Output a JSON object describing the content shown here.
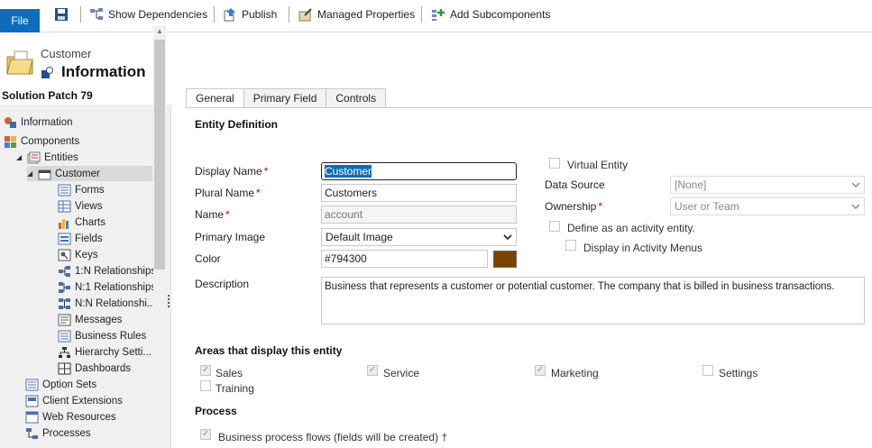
{
  "toolbar": {
    "file": "File",
    "show_dependencies": "Show Dependencies",
    "publish": "Publish",
    "managed_properties": "Managed Properties",
    "add_subcomponents": "Add Subcomponents"
  },
  "header": {
    "entity": "Customer",
    "title": "Information"
  },
  "sidebar": {
    "solution": "Solution Patch 79",
    "items": [
      {
        "label": "Information"
      },
      {
        "label": "Components"
      },
      {
        "label": "Entities"
      },
      {
        "label": "Customer"
      },
      {
        "label": "Forms"
      },
      {
        "label": "Views"
      },
      {
        "label": "Charts"
      },
      {
        "label": "Fields"
      },
      {
        "label": "Keys"
      },
      {
        "label": "1:N Relationships"
      },
      {
        "label": "N:1 Relationships"
      },
      {
        "label": "N:N Relationshi..."
      },
      {
        "label": "Messages"
      },
      {
        "label": "Business Rules"
      },
      {
        "label": "Hierarchy Setti..."
      },
      {
        "label": "Dashboards"
      },
      {
        "label": "Option Sets"
      },
      {
        "label": "Client Extensions"
      },
      {
        "label": "Web Resources"
      },
      {
        "label": "Processes"
      }
    ]
  },
  "tabs": [
    "General",
    "Primary Field",
    "Controls"
  ],
  "form": {
    "entity_definition": "Entity Definition",
    "display_name_label": "Display Name",
    "display_name_value": "Customer",
    "plural_name_label": "Plural Name",
    "plural_name_value": "Customers",
    "name_label": "Name",
    "name_value": "account",
    "primary_image_label": "Primary Image",
    "primary_image_value": "Default Image",
    "color_label": "Color",
    "color_value": "#794300",
    "description_label": "Description",
    "description_value": "Business that represents a customer or potential customer. The company that is billed in business transactions.",
    "virtual_entity": "Virtual Entity",
    "data_source_label": "Data Source",
    "data_source_value": "[None]",
    "ownership_label": "Ownership",
    "ownership_value": "User or Team",
    "activity_entity": "Define as an activity entity.",
    "activity_menus": "Display in Activity Menus",
    "required_mark": "*"
  },
  "areas": {
    "title": "Areas that display this entity",
    "sales": "Sales",
    "service": "Service",
    "marketing": "Marketing",
    "settings": "Settings",
    "training": "Training"
  },
  "process": {
    "title": "Process",
    "bpf": "Business process flows (fields will be created)",
    "bpf_mark": "†"
  },
  "checks": {
    "checked": "✓",
    "collapse": "◢",
    "scroll_up": "▲",
    "chevron": "⌵"
  }
}
